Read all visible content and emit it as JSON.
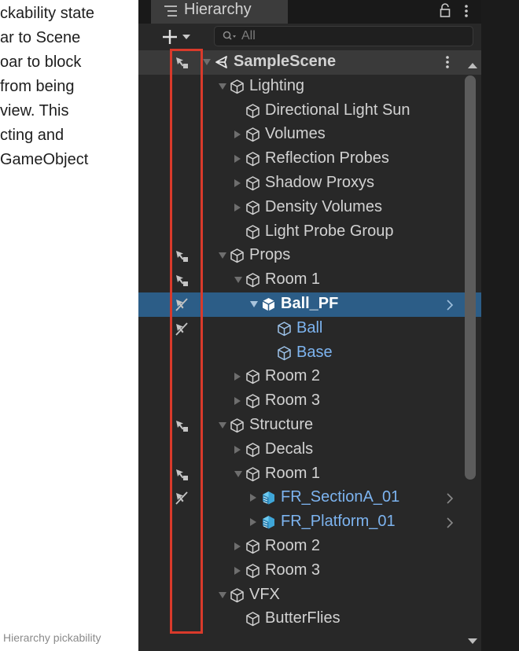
{
  "doc": {
    "lines": [
      "ckability state",
      "ar to Scene",
      "oar to block",
      " from being",
      " view. This",
      "cting and",
      " GameObject"
    ],
    "caption": "Hierarchy pickability"
  },
  "window": {
    "tab_label": "Hierarchy",
    "tab_icon": "hierarchy-list-icon",
    "lock_icon": "lock-icon",
    "menu_icon": "kebab-menu-icon"
  },
  "toolbar": {
    "add_icon": "plus-dropdown-icon",
    "search_placeholder": "All",
    "search_value": ""
  },
  "colors": {
    "panel_bg": "#282828",
    "selected_row": "#2c5d87",
    "prefab_text": "#7db4f0",
    "highlight_box": "#d93a2b"
  },
  "hierarchy": [
    {
      "label": "SampleScene",
      "expand": "expanded",
      "icon": "unity-scene-icon",
      "pickability": "pickable",
      "type": "scene"
    },
    {
      "label": "Lighting",
      "expand": "expanded",
      "icon": "gameobject-cube-icon",
      "pickability": "none",
      "type": "object"
    },
    {
      "label": "Directional Light Sun",
      "expand": "none",
      "icon": "gameobject-cube-icon",
      "pickability": "none",
      "type": "object"
    },
    {
      "label": "Volumes",
      "expand": "collapsed",
      "icon": "gameobject-cube-icon",
      "pickability": "none",
      "type": "object"
    },
    {
      "label": "Reflection Probes",
      "expand": "collapsed",
      "icon": "gameobject-cube-icon",
      "pickability": "none",
      "type": "object"
    },
    {
      "label": "Shadow Proxys",
      "expand": "collapsed",
      "icon": "gameobject-cube-icon",
      "pickability": "none",
      "type": "object"
    },
    {
      "label": "Density Volumes",
      "expand": "collapsed",
      "icon": "gameobject-cube-icon",
      "pickability": "none",
      "type": "object"
    },
    {
      "label": "Light Probe Group",
      "expand": "none",
      "icon": "gameobject-cube-icon",
      "pickability": "none",
      "type": "object"
    },
    {
      "label": "Props",
      "expand": "expanded",
      "icon": "gameobject-cube-icon",
      "pickability": "pickable",
      "type": "object"
    },
    {
      "label": "Room 1",
      "expand": "expanded",
      "icon": "gameobject-cube-icon",
      "pickability": "pickable",
      "type": "object"
    },
    {
      "label": "Ball_PF",
      "expand": "expanded",
      "icon": "prefab-cube-icon",
      "pickability": "unpickable",
      "type": "prefab",
      "selected": true
    },
    {
      "label": "Ball",
      "expand": "none",
      "icon": "gameobject-cube-icon",
      "pickability": "unpickable",
      "type": "prefab-child"
    },
    {
      "label": "Base",
      "expand": "none",
      "icon": "gameobject-cube-icon",
      "pickability": "none",
      "type": "prefab-child"
    },
    {
      "label": "Room 2",
      "expand": "collapsed",
      "icon": "gameobject-cube-icon",
      "pickability": "none",
      "type": "object"
    },
    {
      "label": "Room 3",
      "expand": "collapsed",
      "icon": "gameobject-cube-icon",
      "pickability": "none",
      "type": "object"
    },
    {
      "label": "Structure",
      "expand": "expanded",
      "icon": "gameobject-cube-icon",
      "pickability": "pickable",
      "type": "object"
    },
    {
      "label": "Decals",
      "expand": "collapsed",
      "icon": "gameobject-cube-icon",
      "pickability": "none",
      "type": "object"
    },
    {
      "label": "Room 1",
      "expand": "expanded",
      "icon": "gameobject-cube-icon",
      "pickability": "pickable",
      "type": "object"
    },
    {
      "label": "FR_SectionA_01",
      "expand": "collapsed",
      "icon": "prefab-model-icon",
      "pickability": "unpickable",
      "type": "prefab"
    },
    {
      "label": "FR_Platform_01",
      "expand": "collapsed",
      "icon": "prefab-model-icon",
      "pickability": "none",
      "type": "prefab"
    },
    {
      "label": "Room 2",
      "expand": "collapsed",
      "icon": "gameobject-cube-icon",
      "pickability": "none",
      "type": "object"
    },
    {
      "label": "Room 3",
      "expand": "collapsed",
      "icon": "gameobject-cube-icon",
      "pickability": "none",
      "type": "object"
    },
    {
      "label": "VFX",
      "expand": "expanded",
      "icon": "gameobject-cube-icon",
      "pickability": "none",
      "type": "object"
    },
    {
      "label": "ButterFlies",
      "expand": "none",
      "icon": "gameobject-cube-icon",
      "pickability": "none",
      "type": "object"
    }
  ]
}
